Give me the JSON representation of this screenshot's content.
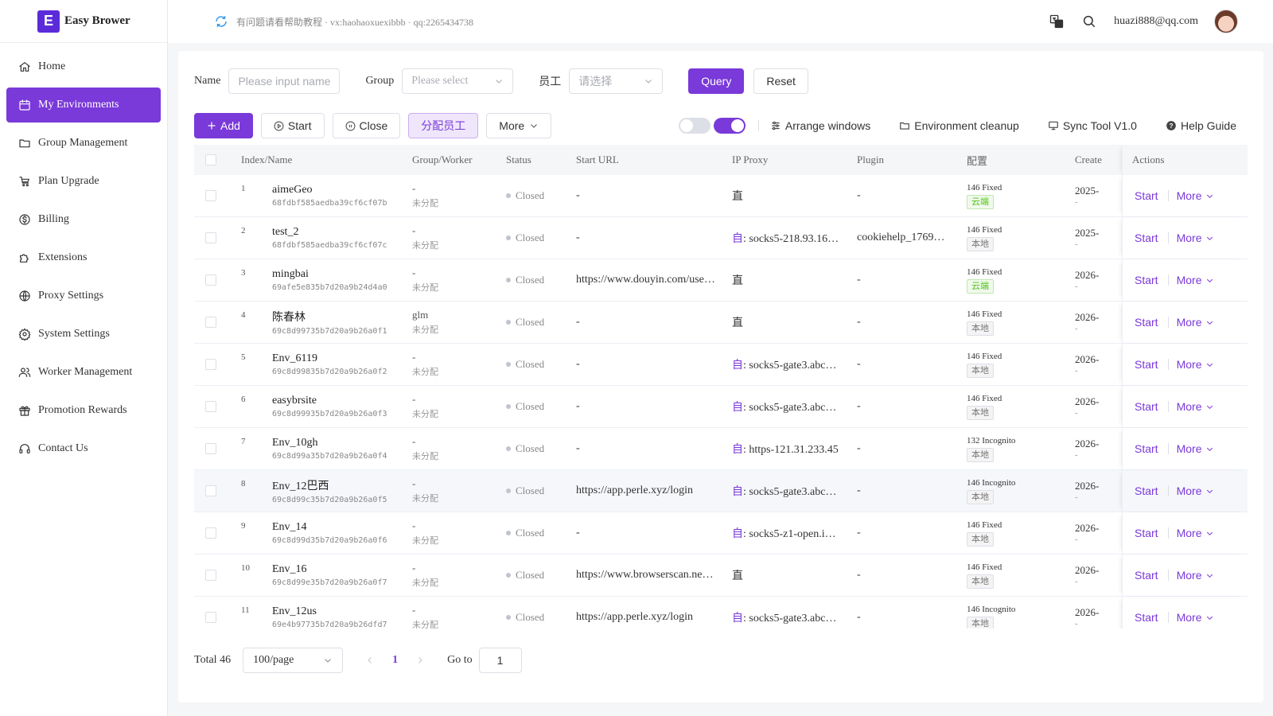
{
  "brand": {
    "logo_letter": "E",
    "name": "Easy Brower"
  },
  "sidebar": {
    "items": [
      {
        "label": "Home",
        "icon": "home-icon"
      },
      {
        "label": "My Environments",
        "icon": "calendar-icon",
        "active": true
      },
      {
        "label": "Group Management",
        "icon": "folder-icon"
      },
      {
        "label": "Plan Upgrade",
        "icon": "cart-icon"
      },
      {
        "label": "Billing",
        "icon": "dollar-icon"
      },
      {
        "label": "Extensions",
        "icon": "puzzle-icon"
      },
      {
        "label": "Proxy Settings",
        "icon": "globe-icon"
      },
      {
        "label": "System Settings",
        "icon": "gear-icon"
      },
      {
        "label": "Worker Management",
        "icon": "users-icon"
      },
      {
        "label": "Promotion Rewards",
        "icon": "gift-icon"
      },
      {
        "label": "Contact Us",
        "icon": "headset-icon"
      }
    ]
  },
  "header": {
    "notice": "有问题请看帮助教程 · vx:haohaoxuexibbb · qq:2265434738",
    "email": "huazi888@qq.com"
  },
  "filter": {
    "name_label": "Name",
    "name_placeholder": "Please input name",
    "group_label": "Group",
    "group_placeholder": "Please select",
    "worker_label": "员工",
    "worker_placeholder": "请选择",
    "query": "Query",
    "reset": "Reset"
  },
  "toolbar": {
    "add": "Add",
    "start": "Start",
    "close": "Close",
    "assign": "分配员工",
    "more": "More",
    "arrange": "Arrange windows",
    "cleanup": "Environment cleanup",
    "sync": "Sync Tool V1.0",
    "help": "Help Guide"
  },
  "table": {
    "headers": {
      "index_name": "Index/Name",
      "group_worker": "Group/Worker",
      "status": "Status",
      "start_url": "Start URL",
      "ip_proxy": "IP Proxy",
      "plugin": "Plugin",
      "config": "配置",
      "create": "Create",
      "actions": "Actions"
    },
    "start_label": "Start",
    "more_label": "More",
    "rows": [
      {
        "index": "1",
        "name": "aimeGeo",
        "id": "68fdbf585aedba39cf6cf07b",
        "group": "-",
        "worker": "未分配",
        "status": "Closed",
        "url": "-",
        "proxy_prefix": "",
        "proxy": "直",
        "plugin": "-",
        "cfg": "146  Fixed",
        "tag": "云端",
        "tag_type": "cloud",
        "create": "2025-",
        "create_sub": "-"
      },
      {
        "index": "2",
        "name": "test_2",
        "id": "68fdbf585aedba39cf6cf07c",
        "group": "-",
        "worker": "未分配",
        "status": "Closed",
        "url": "-",
        "proxy_prefix": "自",
        "proxy": ": socks5-218.93.16…",
        "plugin": "cookiehelp_1769…",
        "cfg": "146  Fixed",
        "tag": "本地",
        "tag_type": "local",
        "create": "2025-",
        "create_sub": "-"
      },
      {
        "index": "3",
        "name": "mingbai",
        "id": "69afe5e835b7d20a9b24d4a0",
        "group": "-",
        "worker": "未分配",
        "status": "Closed",
        "url": "https://www.douyin.com/use…",
        "proxy_prefix": "",
        "proxy": "直",
        "plugin": "-",
        "cfg": "146  Fixed",
        "tag": "云端",
        "tag_type": "cloud",
        "create": "2026-",
        "create_sub": "-"
      },
      {
        "index": "4",
        "name": "陈春林",
        "id": "69c8d99735b7d20a9b26a0f1",
        "group": "glm",
        "worker": "未分配",
        "status": "Closed",
        "url": "-",
        "proxy_prefix": "",
        "proxy": "直",
        "plugin": "-",
        "cfg": "146  Fixed",
        "tag": "本地",
        "tag_type": "local",
        "create": "2026-",
        "create_sub": "-"
      },
      {
        "index": "5",
        "name": "Env_6119",
        "id": "69c8d99835b7d20a9b26a0f2",
        "group": "-",
        "worker": "未分配",
        "status": "Closed",
        "url": "-",
        "proxy_prefix": "自",
        "proxy": ": socks5-gate3.abc…",
        "plugin": "-",
        "cfg": "146  Fixed",
        "tag": "本地",
        "tag_type": "local",
        "create": "2026-",
        "create_sub": "-"
      },
      {
        "index": "6",
        "name": "easybrsite",
        "id": "69c8d99935b7d20a9b26a0f3",
        "group": "-",
        "worker": "未分配",
        "status": "Closed",
        "url": "-",
        "proxy_prefix": "自",
        "proxy": ": socks5-gate3.abc…",
        "plugin": "-",
        "cfg": "146  Fixed",
        "tag": "本地",
        "tag_type": "local",
        "create": "2026-",
        "create_sub": "-"
      },
      {
        "index": "7",
        "name": "Env_10gh",
        "id": "69c8d99a35b7d20a9b26a0f4",
        "group": "-",
        "worker": "未分配",
        "status": "Closed",
        "url": "-",
        "proxy_prefix": "自",
        "proxy": ": https-121.31.233.45",
        "plugin": "-",
        "cfg": "132  Incognito",
        "tag": "本地",
        "tag_type": "local",
        "create": "2026-",
        "create_sub": "-"
      },
      {
        "index": "8",
        "name": "Env_12巴西",
        "id": "69c8d99c35b7d20a9b26a0f5",
        "group": "-",
        "worker": "未分配",
        "status": "Closed",
        "url": "https://app.perle.xyz/login",
        "proxy_prefix": "自",
        "proxy": ": socks5-gate3.abc…",
        "plugin": "-",
        "cfg": "146  Incognito",
        "tag": "本地",
        "tag_type": "local",
        "create": "2026-",
        "create_sub": "-"
      },
      {
        "index": "9",
        "name": "Env_14",
        "id": "69c8d99d35b7d20a9b26a0f6",
        "group": "-",
        "worker": "未分配",
        "status": "Closed",
        "url": "-",
        "proxy_prefix": "自",
        "proxy": ": socks5-z1-open.i…",
        "plugin": "-",
        "cfg": "146  Fixed",
        "tag": "本地",
        "tag_type": "local",
        "create": "2026-",
        "create_sub": "-"
      },
      {
        "index": "10",
        "name": "Env_16",
        "id": "69c8d99e35b7d20a9b26a0f7",
        "group": "-",
        "worker": "未分配",
        "status": "Closed",
        "url": "https://www.browserscan.ne…",
        "proxy_prefix": "",
        "proxy": "直",
        "plugin": "-",
        "cfg": "146  Fixed",
        "tag": "本地",
        "tag_type": "local",
        "create": "2026-",
        "create_sub": "-"
      },
      {
        "index": "11",
        "name": "Env_12us",
        "id": "69e4b97735b7d20a9b26dfd7",
        "group": "-",
        "worker": "未分配",
        "status": "Closed",
        "url": "https://app.perle.xyz/login",
        "proxy_prefix": "自",
        "proxy": ": socks5-gate3.abc…",
        "plugin": "-",
        "cfg": "146  Incognito",
        "tag": "本地",
        "tag_type": "local",
        "create": "2026-",
        "create_sub": "-"
      }
    ]
  },
  "pagination": {
    "total": "Total 46",
    "page_size": "100/page",
    "current": "1",
    "goto_label": "Go to",
    "goto_value": "1"
  }
}
